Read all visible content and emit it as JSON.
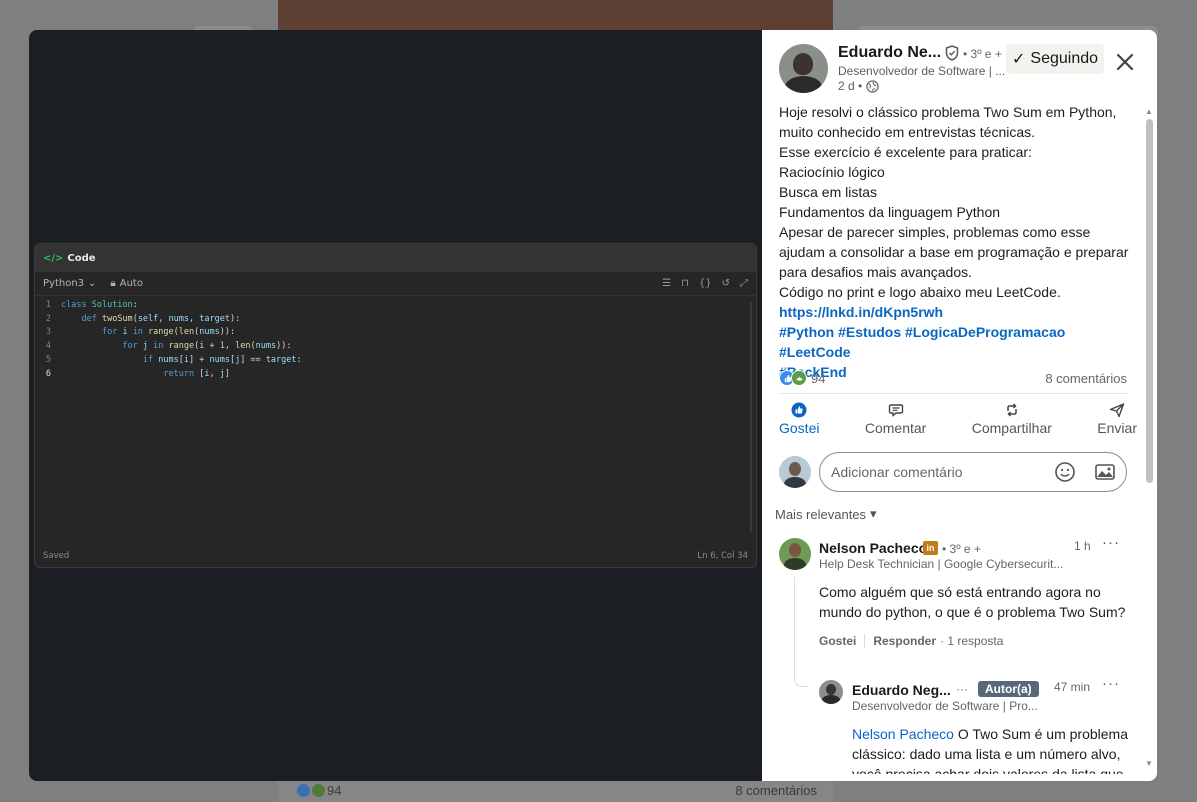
{
  "background": {
    "reaction_count": "94",
    "comments_count": "8 comentários"
  },
  "editor": {
    "title": "Code",
    "language": "Python3",
    "mode": "Auto",
    "lines": [
      {
        "num": "1",
        "text": "class Solution:"
      },
      {
        "num": "2",
        "text": "    def twoSum(self, nums, target):"
      },
      {
        "num": "3",
        "text": "        for i in range(len(nums)):"
      },
      {
        "num": "4",
        "text": "            for j in range(i + 1, len(nums)):"
      },
      {
        "num": "5",
        "text": "                if nums[i] + nums[j] == target:"
      },
      {
        "num": "6",
        "text": "                    return [i, j]"
      }
    ],
    "status": "Saved",
    "cursor": "Ln 6, Col 34"
  },
  "post": {
    "author_name": "Eduardo Ne...",
    "degree": "• 3º e +",
    "author_headline": "Desenvolvedor de Software | ...",
    "time": "2 d •",
    "follow_label": "Seguindo",
    "text_lines": [
      "Hoje resolvi o clássico problema Two Sum em Python,",
      "muito conhecido em entrevistas técnicas.",
      "Esse exercício é excelente para praticar:",
      "Raciocínio lógico",
      "Busca em listas",
      "Fundamentos da linguagem Python",
      "Apesar de parecer simples, problemas como esse",
      "ajudam a consolidar a base em programação e preparar",
      "para desafios mais avançados.",
      "Código no print e logo abaixo meu LeetCode."
    ],
    "link": "https://lnkd.in/dKpn5rwh",
    "hashtags_line1": "#Python #Estudos #LogicaDeProgramacao #LeetCode",
    "hashtags_line2": " #BackEnd",
    "reaction_count": "94",
    "comments_count": "8 comentários"
  },
  "actions": {
    "like": "Gostei",
    "comment": "Comentar",
    "share": "Compartilhar",
    "send": "Enviar"
  },
  "composer": {
    "placeholder": "Adicionar comentário"
  },
  "sort_label": "Mais relevantes",
  "comment1": {
    "name": "Nelson Pacheco",
    "badge": "in",
    "degree": "• 3º e +",
    "time": "1 h",
    "headline": "Help Desk Technician | Google Cybersecurit...",
    "text": "Como alguém que só está entrando agora no mundo do python, o que é o problema Two Sum?",
    "like": "Gostei",
    "reply": "Responder",
    "replies": "· 1 resposta"
  },
  "comment2": {
    "name": "Eduardo Neg...",
    "dots": "···",
    "badge": "Autor(a)",
    "time": "47 min",
    "headline": "Desenvolvedor de Software | Pro...",
    "mention": "Nelson Pacheco",
    "text": " O Two Sum é um problema clássico: dado uma lista e um número alvo, você precisa achar dois valores da lista que"
  },
  "colors": {
    "accent": "#0a66c2",
    "editor_bg": "#262626",
    "media_bg": "#1b1f23",
    "li_badge": "#c37d16",
    "author_badge": "#56687a"
  }
}
